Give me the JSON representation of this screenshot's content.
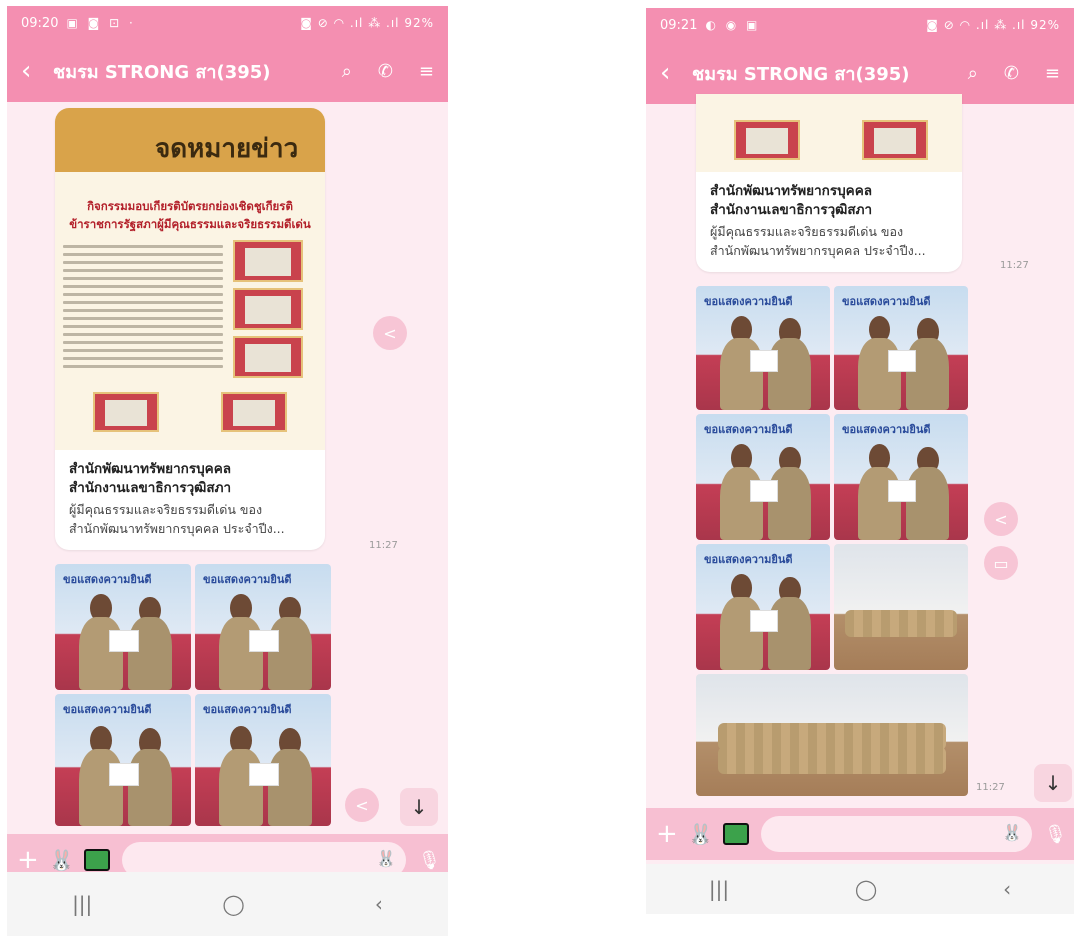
{
  "screens": [
    {
      "status": {
        "time": "09:20",
        "battery": "92%",
        "left_icons": "▣ ◙ ⊡ ·",
        "right_icons": "◙ ⊘ ◠ .ıl ⁂ .ıl"
      },
      "header": {
        "back": "‹",
        "title": "ชมรม STRONG สา(395)",
        "search_icon": "⌕",
        "call_icon": "✆",
        "menu_icon": "≡"
      },
      "card": {
        "poster_title_1": "กิจกรรมมอบเกียรติบัตรยกย่องเชิดชูเกียรติ",
        "poster_title_2": "ข้าราชการรัฐสภาผู้มีคุณธรรมและจริยธรรมดีเด่น",
        "poster_name": "จดหมายข่าว",
        "title_line1": "สำนักพัฒนาทรัพยากรบุคคล",
        "title_line2": "สำนักงานเลขาธิการวุฒิสภา",
        "desc_line1": "ผู้มีคุณธรรมและจริยธรรมดีเด่น ของ",
        "desc_line2": "สำนักพัฒนาทรัพยากรบุคคล ประจำปีง..."
      },
      "timestamp": "11:27",
      "photo_caption": "ขอแสดงความยินดี",
      "scroll_icon": "↓",
      "share_icon": "<",
      "input": {
        "plus": "+",
        "sticker": "🐰",
        "emoji": "🐰",
        "mic": "🎙"
      },
      "nav": {
        "recent": "|||",
        "home": "◯",
        "back": "‹"
      }
    },
    {
      "status": {
        "time": "09:21",
        "battery": "92%",
        "left_icons": "◐ ◉ ▣",
        "right_icons": "◙ ⊘ ◠ .ıl ⁂ .ıl"
      },
      "header": {
        "back": "‹",
        "title": "ชมรม STRONG สา(395)",
        "search_icon": "⌕",
        "call_icon": "✆",
        "menu_icon": "≡"
      },
      "card": {
        "title_line1": "สำนักพัฒนาทรัพยากรบุคคล",
        "title_line2": "สำนักงานเลขาธิการวุฒิสภา",
        "desc_line1": "ผู้มีคุณธรรมและจริยธรรมดีเด่น ของ",
        "desc_line2": "สำนักพัฒนาทรัพยากรบุคคล ประจำปีง..."
      },
      "timestamp_card": "11:27",
      "timestamp_photos": "11:27",
      "photo_caption": "ขอแสดงความยินดี",
      "scroll_icon": "↓",
      "share_icon": "<",
      "save_icon": "▭",
      "input": {
        "plus": "+",
        "sticker": "🐰",
        "emoji": "🐰",
        "mic": "🎙"
      },
      "nav": {
        "recent": "|||",
        "home": "◯",
        "back": "‹"
      }
    }
  ]
}
